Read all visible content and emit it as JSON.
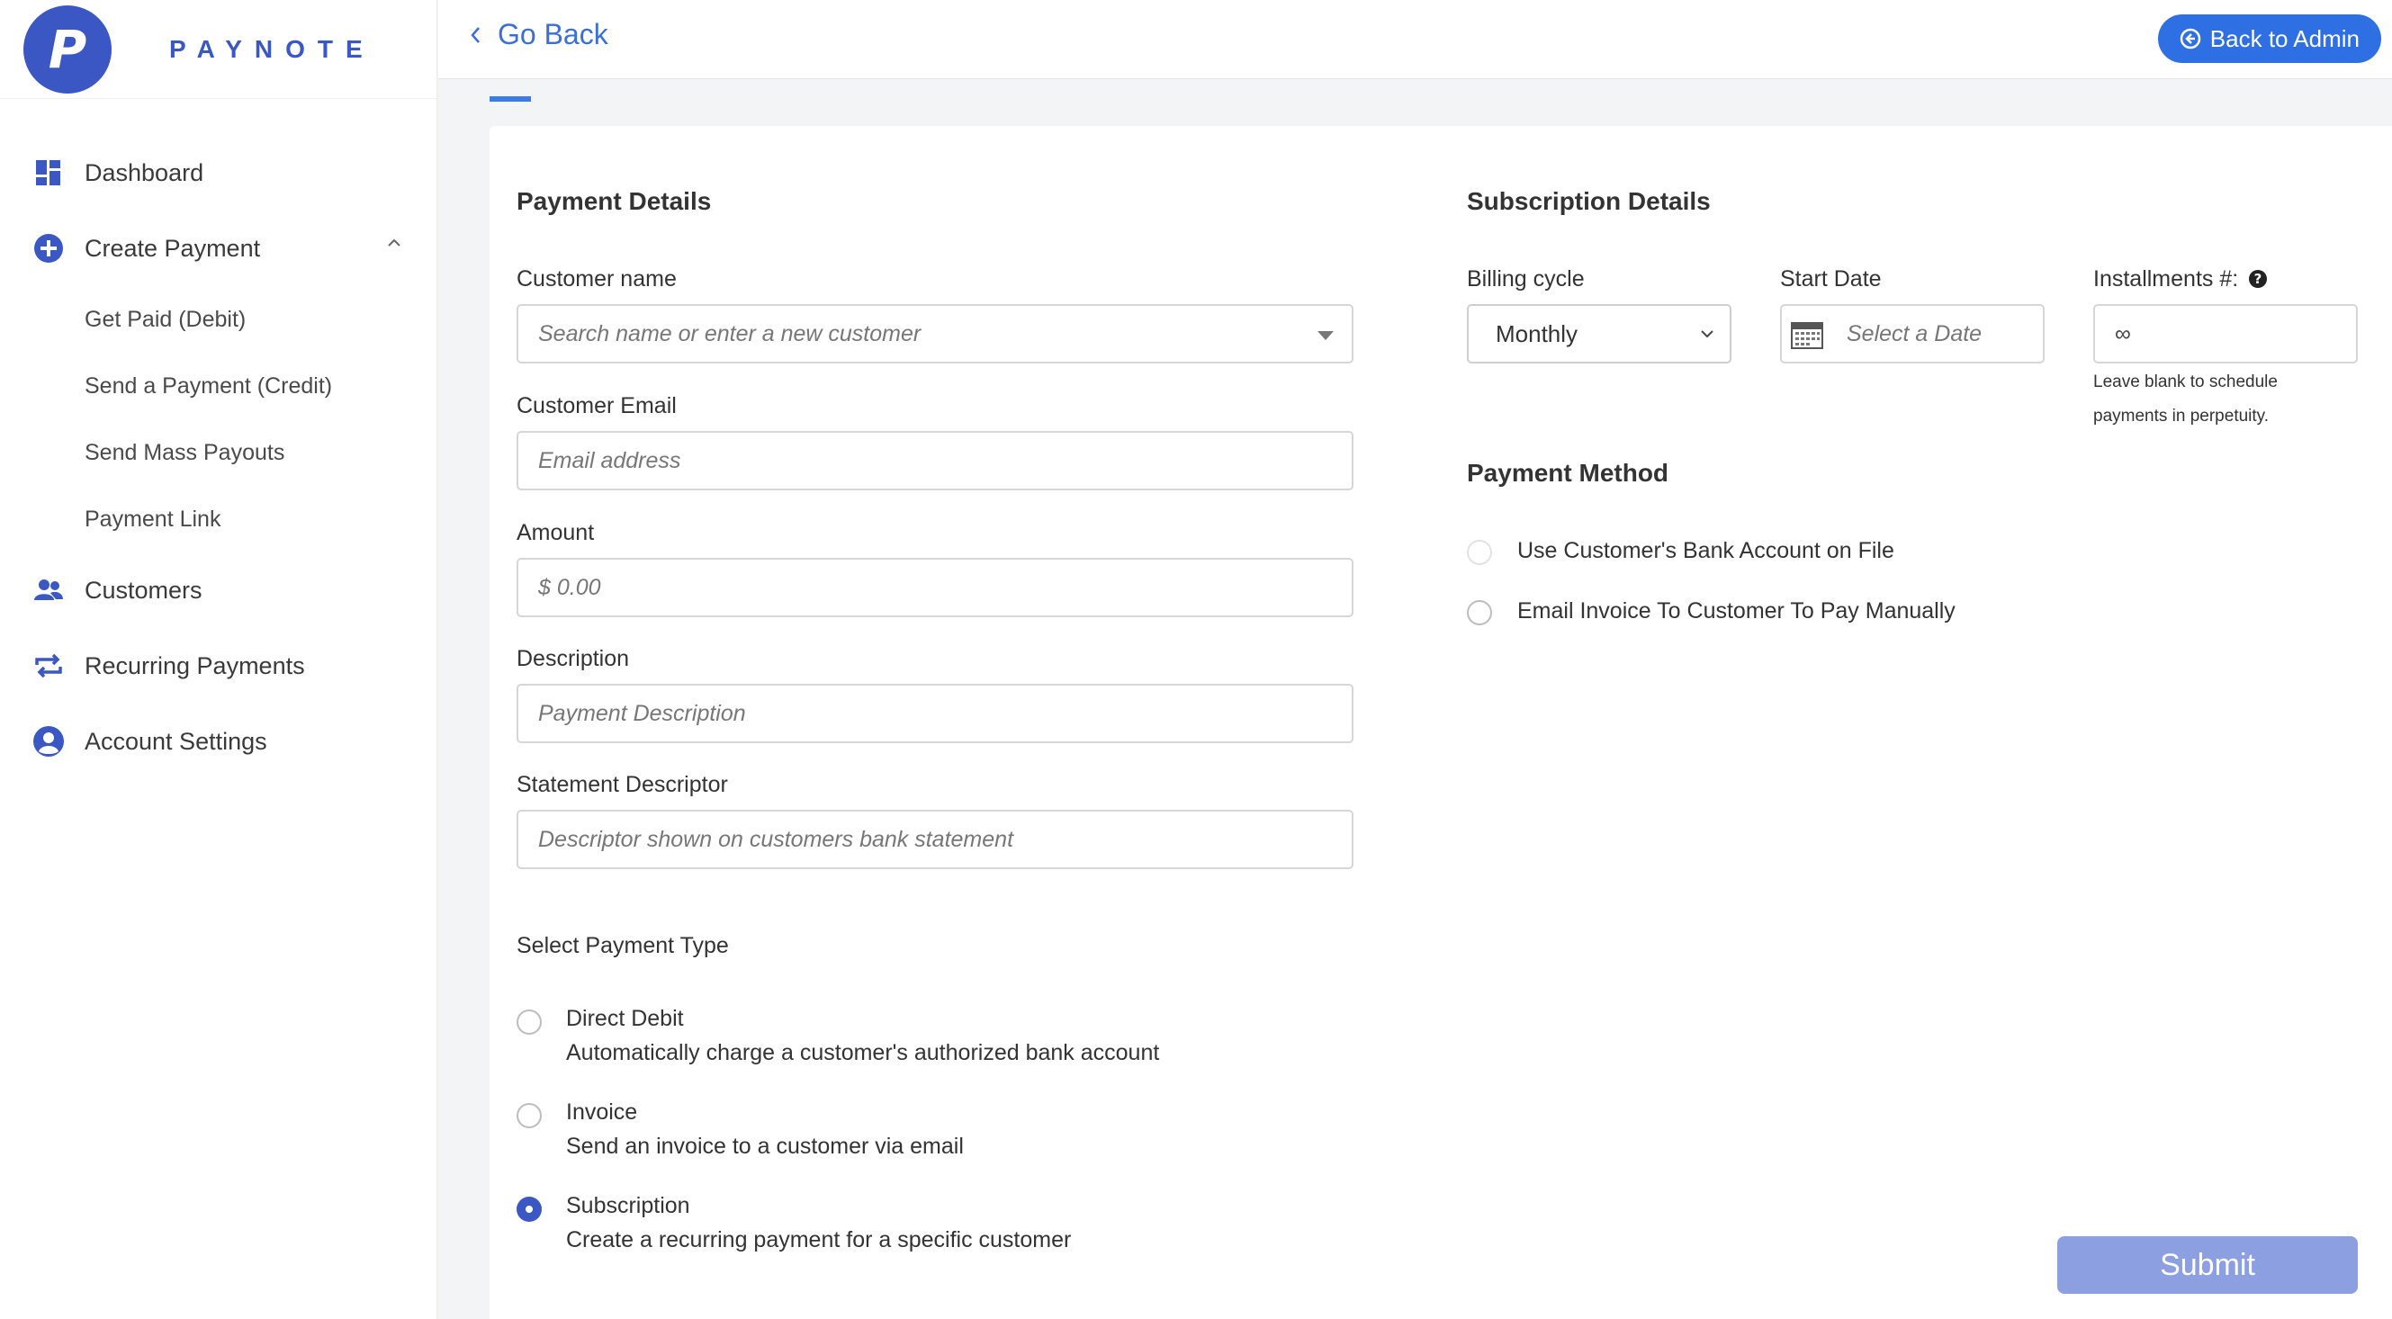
{
  "brand": {
    "logo_letter": "P",
    "name": "PAYNOTE",
    "color": "#3a57c4"
  },
  "sidebar": {
    "items": [
      {
        "label": "Dashboard",
        "icon": "dashboard-icon"
      },
      {
        "label": "Create Payment",
        "icon": "plus-circle-icon",
        "expanded": true
      },
      {
        "label": "Customers",
        "icon": "users-icon"
      },
      {
        "label": "Recurring Payments",
        "icon": "repeat-icon"
      },
      {
        "label": "Account Settings",
        "icon": "user-circle-icon"
      }
    ],
    "sub_items": [
      {
        "label": "Get Paid (Debit)"
      },
      {
        "label": "Send a Payment (Credit)"
      },
      {
        "label": "Send Mass Payouts"
      },
      {
        "label": "Payment Link"
      }
    ]
  },
  "header": {
    "go_back": "Go Back",
    "back_to_admin": "Back to Admin"
  },
  "payment_details": {
    "title": "Payment Details",
    "customer_name": {
      "label": "Customer name",
      "placeholder": "Search name or enter a new customer"
    },
    "customer_email": {
      "label": "Customer Email",
      "placeholder": "Email address"
    },
    "amount": {
      "label": "Amount",
      "placeholder": "$ 0.00"
    },
    "description": {
      "label": "Description",
      "placeholder": "Payment Description"
    },
    "statement_descriptor": {
      "label": "Statement Descriptor",
      "placeholder": "Descriptor shown on customers bank statement"
    }
  },
  "payment_type": {
    "title": "Select Payment Type",
    "options": [
      {
        "title": "Direct Debit",
        "desc": "Automatically charge a customer's authorized bank account",
        "checked": false
      },
      {
        "title": "Invoice",
        "desc": "Send an invoice to a customer via email",
        "checked": false
      },
      {
        "title": "Subscription",
        "desc": "Create a recurring payment for a specific customer",
        "checked": true
      }
    ]
  },
  "subscription": {
    "title": "Subscription Details",
    "billing_cycle": {
      "label": "Billing cycle",
      "value": "Monthly"
    },
    "start_date": {
      "label": "Start Date",
      "placeholder": "Select a Date"
    },
    "installments": {
      "label": "Installments #:",
      "value": "∞",
      "help_line1": "Leave blank to schedule",
      "help_line2": "payments in perpetuity."
    }
  },
  "payment_method": {
    "title": "Payment Method",
    "options": [
      {
        "label": "Use Customer's Bank Account on File",
        "disabled": true
      },
      {
        "label": "Email Invoice To Customer To Pay Manually",
        "disabled": false
      }
    ]
  },
  "submit_label": "Submit",
  "colors": {
    "accent": "#2f6fe4",
    "submit": "#8c9fe1",
    "link": "#3b6fd8"
  }
}
